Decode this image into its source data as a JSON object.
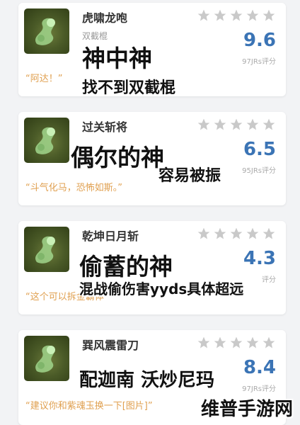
{
  "cards": [
    {
      "name": "虎啸龙咆",
      "sub": "双截棍",
      "score": "9.6",
      "count": "97JRs评分",
      "quote": "“阿达！”",
      "overlay_big": "神中神",
      "overlay_mid": "找不到双截棍",
      "stars": 5
    },
    {
      "name": "过关斩将",
      "sub": "",
      "score": "6.5",
      "count": "95JRs评分",
      "quote": "“斗气化马，恐怖如斯。”",
      "overlay_big": "偶尔的神",
      "overlay_mid": "容易被振",
      "stars": 5
    },
    {
      "name": "乾坤日月斩",
      "sub": "",
      "score": "4.3",
      "count": "评分",
      "quote": "“这个可以拆金霸体”",
      "overlay_big": "偷蓄的神",
      "overlay_mid": "混战偷伤害yyds具体超远",
      "stars": 5
    },
    {
      "name": "巽风震雷刀",
      "sub": "",
      "score": "8.4",
      "count": "97JRs评分",
      "quote": "“建议你和紫魂玉换一下[图片]”",
      "overlay_big": "配迦南 沃炒尼玛",
      "overlay_mid": "",
      "stars": 5
    }
  ],
  "watermark": "维普手游网",
  "colors": {
    "score": "#3b74b5",
    "quote": "#e0a050",
    "star_inactive": "#c9c9c9"
  },
  "icons": {
    "thumb": "jade-serpent-weapon-icon",
    "star": "star-icon"
  }
}
